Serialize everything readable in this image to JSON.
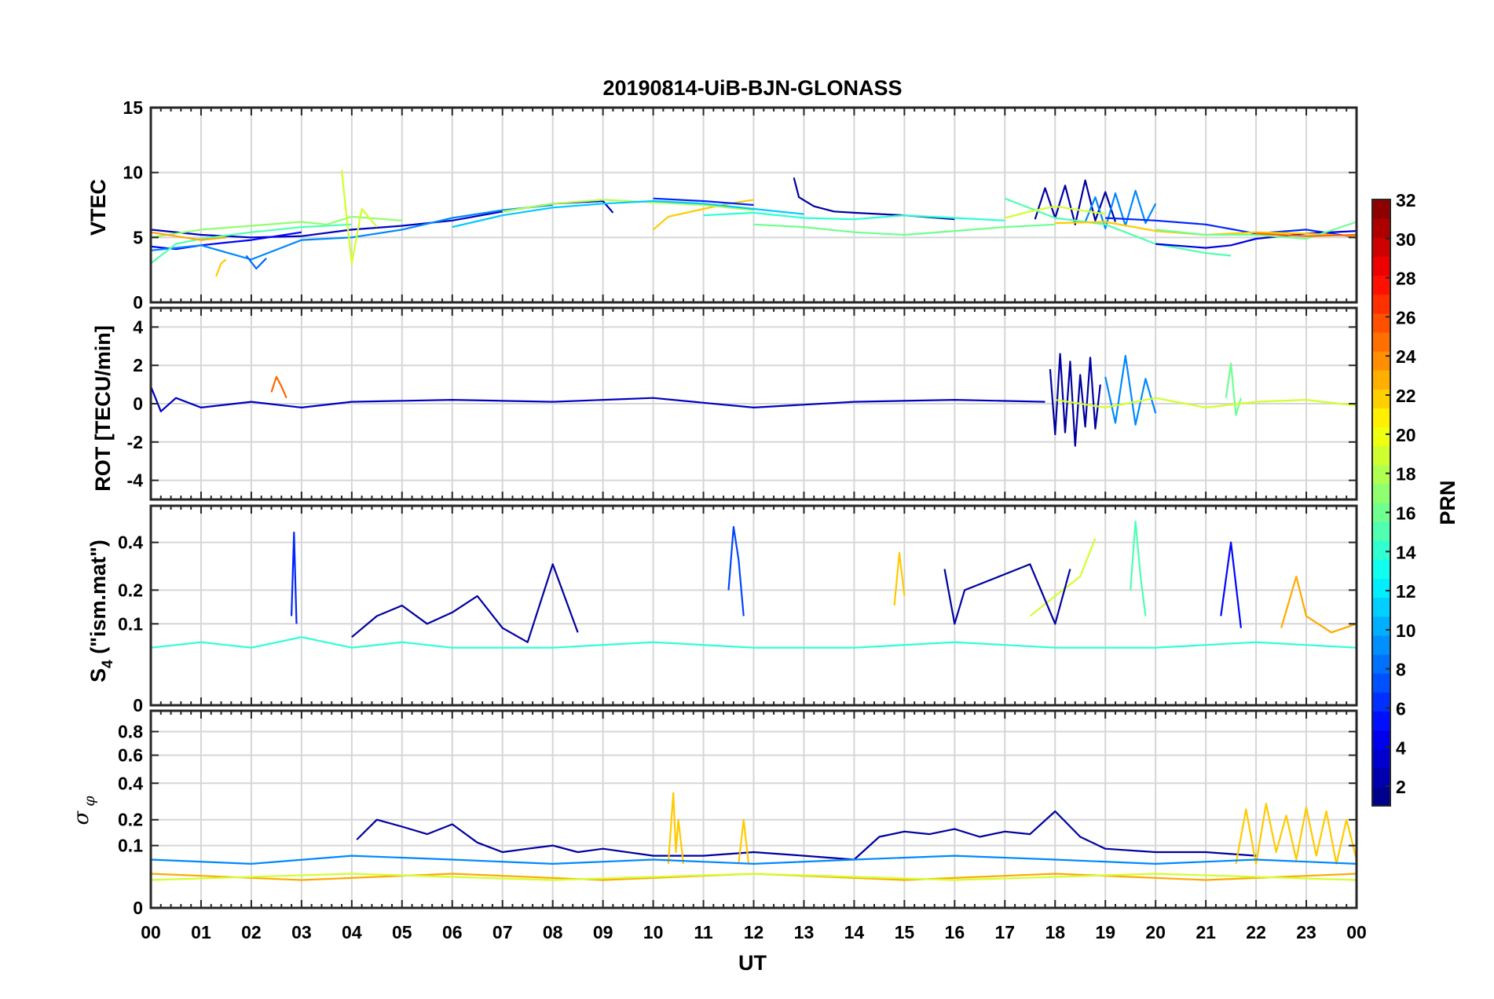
{
  "figure": {
    "title": "20190814-UiB-BJN-GLONASS",
    "xlabel": "UT",
    "x_ticks": [
      "00",
      "01",
      "02",
      "03",
      "04",
      "05",
      "06",
      "07",
      "08",
      "09",
      "10",
      "11",
      "12",
      "13",
      "14",
      "15",
      "16",
      "17",
      "18",
      "19",
      "20",
      "21",
      "22",
      "23",
      "00"
    ]
  },
  "colorbar": {
    "label": "PRN",
    "ticks": [
      "2",
      "4",
      "6",
      "8",
      "10",
      "12",
      "14",
      "16",
      "18",
      "20",
      "22",
      "24",
      "26",
      "28",
      "30",
      "32"
    ],
    "range": [
      1,
      32
    ],
    "colormap": "jet"
  },
  "chart_data": [
    {
      "type": "line",
      "ylabel": "VTEC",
      "xlim": [
        0,
        24
      ],
      "ylim": [
        0,
        15
      ],
      "y_ticks": [
        "0",
        "5",
        "10",
        "15"
      ],
      "grid": true,
      "series": [
        {
          "prn": 3,
          "x": [
            0,
            1,
            2,
            3,
            4,
            5,
            6,
            7,
            8,
            9,
            9.2
          ],
          "y": [
            5.6,
            5.2,
            5.0,
            5.1,
            5.6,
            5.9,
            6.3,
            7.0,
            7.6,
            7.8,
            6.9
          ]
        },
        {
          "prn": 5,
          "x": [
            0,
            0.5,
            1,
            1.5,
            2,
            2.5,
            3
          ],
          "y": [
            4.3,
            4.1,
            4.4,
            4.6,
            4.8,
            5.1,
            5.4
          ]
        },
        {
          "prn": 9,
          "x": [
            0,
            1,
            2,
            3,
            4,
            5,
            6,
            7,
            8
          ],
          "y": [
            4.0,
            4.4,
            3.3,
            4.8,
            5.0,
            5.6,
            6.5,
            7.1,
            7.5
          ]
        },
        {
          "prn": 15,
          "x": [
            0,
            0.5,
            1,
            2,
            3,
            4
          ],
          "y": [
            3.0,
            4.5,
            4.9,
            5.4,
            5.8,
            6.0
          ]
        },
        {
          "prn": 17,
          "x": [
            0,
            1,
            2,
            3,
            3.5,
            4,
            5
          ],
          "y": [
            5.0,
            5.6,
            5.9,
            6.2,
            6.0,
            6.6,
            6.3
          ]
        },
        {
          "prn": 19,
          "x": [
            3.8,
            3.9,
            4.0,
            4.2,
            4.5
          ],
          "y": [
            10.2,
            6.5,
            3.0,
            7.2,
            5.8
          ]
        },
        {
          "prn": 23,
          "x": [
            0,
            0.5,
            1,
            1.5
          ],
          "y": [
            5.4,
            5.1,
            4.8,
            5.0
          ]
        },
        {
          "prn": 22,
          "x": [
            1.3,
            1.4,
            1.5
          ],
          "y": [
            2.0,
            3.0,
            3.3
          ]
        },
        {
          "prn": 8,
          "x": [
            1.9,
            2.1,
            2.3
          ],
          "y": [
            3.6,
            2.6,
            3.4
          ]
        },
        {
          "prn": 22,
          "x": [
            10,
            10.3,
            11,
            11.5,
            12
          ],
          "y": [
            5.6,
            6.6,
            7.2,
            7.6,
            7.9
          ]
        },
        {
          "prn": 18,
          "x": [
            7,
            8,
            9,
            10,
            11,
            12
          ],
          "y": [
            7.0,
            7.6,
            7.9,
            7.7,
            7.5,
            7.1
          ]
        },
        {
          "prn": 11,
          "x": [
            6,
            7,
            8,
            9,
            10,
            11,
            12,
            13
          ],
          "y": [
            5.8,
            6.7,
            7.3,
            7.6,
            7.8,
            7.6,
            7.2,
            6.8
          ]
        },
        {
          "prn": 6,
          "x": [
            10,
            11,
            12
          ],
          "y": [
            8.0,
            7.8,
            7.5
          ]
        },
        {
          "prn": 2,
          "x": [
            12.8,
            12.9,
            13.2,
            13.6,
            14,
            15,
            16
          ],
          "y": [
            9.6,
            8.1,
            7.4,
            7.0,
            6.9,
            6.7,
            6.4
          ]
        },
        {
          "prn": 14,
          "x": [
            11,
            12,
            13,
            14,
            15,
            16,
            17
          ],
          "y": [
            6.7,
            6.9,
            6.5,
            6.4,
            6.7,
            6.5,
            6.3
          ]
        },
        {
          "prn": 16,
          "x": [
            12,
            13,
            14,
            15,
            16,
            17,
            18
          ],
          "y": [
            6.0,
            5.8,
            5.4,
            5.2,
            5.5,
            5.8,
            6.0
          ]
        },
        {
          "prn": 2,
          "x": [
            17.6,
            17.8,
            18,
            18.2,
            18.4,
            18.6,
            18.8,
            19.0,
            19.2
          ],
          "y": [
            6.4,
            8.8,
            6.5,
            9.0,
            6.0,
            9.4,
            6.3,
            8.5,
            6.2
          ]
        },
        {
          "prn": 9,
          "x": [
            18.6,
            18.8,
            19,
            19.2,
            19.4,
            19.6,
            19.8,
            20.0
          ],
          "y": [
            6.2,
            8.1,
            5.7,
            8.4,
            5.9,
            8.6,
            6.1,
            7.6
          ]
        },
        {
          "prn": 15,
          "x": [
            17,
            18,
            19,
            20,
            21,
            21.5
          ],
          "y": [
            8.0,
            6.5,
            6.0,
            4.5,
            3.8,
            3.6
          ]
        },
        {
          "prn": 6,
          "x": [
            19,
            20,
            21,
            22,
            23,
            24
          ],
          "y": [
            6.5,
            6.3,
            6.0,
            5.3,
            5.6,
            5.0
          ]
        },
        {
          "prn": 4,
          "x": [
            20,
            21,
            21.5,
            22,
            23,
            24
          ],
          "y": [
            4.5,
            4.2,
            4.4,
            4.9,
            5.3,
            5.5
          ]
        },
        {
          "prn": 22,
          "x": [
            18,
            19,
            20,
            21,
            22,
            23,
            24
          ],
          "y": [
            6.1,
            6.2,
            5.5,
            5.2,
            5.4,
            5.3,
            5.1
          ]
        },
        {
          "prn": 16,
          "x": [
            20,
            21,
            22,
            23,
            24
          ],
          "y": [
            5.6,
            5.2,
            5.2,
            4.9,
            6.2
          ]
        },
        {
          "prn": 19,
          "x": [
            17,
            17.5,
            18,
            19
          ],
          "y": [
            6.5,
            7.0,
            7.4,
            6.8
          ]
        },
        {
          "prn": 25,
          "x": [
            22,
            23,
            24
          ],
          "y": [
            5.3,
            5.1,
            5.2
          ]
        }
      ]
    },
    {
      "type": "line",
      "ylabel": "ROT [TECU/min]",
      "xlim": [
        0,
        24
      ],
      "ylim": [
        -5,
        5
      ],
      "y_ticks": [
        "-4",
        "-2",
        "0",
        "2",
        "4"
      ],
      "grid": true,
      "series": [
        {
          "prn": 3,
          "x": [
            0,
            0.2,
            0.5,
            1,
            2,
            3,
            4,
            6,
            8,
            10,
            12,
            14,
            16,
            17.8
          ],
          "y": [
            0.9,
            -0.4,
            0.3,
            -0.2,
            0.1,
            -0.2,
            0.1,
            0.2,
            0.1,
            0.3,
            -0.2,
            0.1,
            0.2,
            0.1
          ]
        },
        {
          "prn": 25,
          "x": [
            2.4,
            2.5,
            2.6,
            2.7
          ],
          "y": [
            0.6,
            1.4,
            0.9,
            0.3
          ]
        },
        {
          "prn": 2,
          "x": [
            17.9,
            18.0,
            18.1,
            18.2,
            18.3,
            18.4,
            18.5,
            18.6,
            18.7,
            18.8,
            18.9
          ],
          "y": [
            1.8,
            -1.6,
            2.6,
            -1.5,
            2.2,
            -2.2,
            1.5,
            -1.2,
            2.4,
            -1.3,
            1.0
          ]
        },
        {
          "prn": 9,
          "x": [
            19.0,
            19.2,
            19.4,
            19.6,
            19.8,
            20.0
          ],
          "y": [
            1.4,
            -1.0,
            2.5,
            -1.1,
            1.3,
            -0.5
          ]
        },
        {
          "prn": 16,
          "x": [
            21.4,
            21.5,
            21.6,
            21.7
          ],
          "y": [
            0.3,
            2.1,
            -0.6,
            0.3
          ]
        },
        {
          "prn": 19,
          "x": [
            18,
            19,
            20,
            21,
            22,
            23,
            24
          ],
          "y": [
            0.2,
            -0.2,
            0.3,
            -0.2,
            0.1,
            0.2,
            -0.1
          ]
        }
      ]
    },
    {
      "type": "line",
      "ylabel": "S4 (\"ism.mat\")",
      "xlim": [
        0,
        24
      ],
      "ylim": [
        0,
        0.6
      ],
      "y_ticks": [
        "0",
        "0.1",
        "0.2",
        "0.4"
      ],
      "grid": true,
      "series": [
        {
          "prn": 2,
          "x": [
            4,
            4.5,
            5,
            5.5,
            6,
            6.5,
            7,
            7.5,
            8,
            8.5
          ],
          "y": [
            0.07,
            0.12,
            0.15,
            0.1,
            0.13,
            0.18,
            0.09,
            0.06,
            0.3,
            0.08
          ]
        },
        {
          "prn": 6,
          "x": [
            2.8,
            2.85,
            2.9
          ],
          "y": [
            0.12,
            0.45,
            0.1
          ]
        },
        {
          "prn": 7,
          "x": [
            11.5,
            11.6,
            11.7,
            11.8
          ],
          "y": [
            0.2,
            0.48,
            0.32,
            0.12
          ]
        },
        {
          "prn": 15,
          "x": [
            19.5,
            19.6,
            19.7,
            19.8
          ],
          "y": [
            0.2,
            0.51,
            0.25,
            0.12
          ]
        },
        {
          "prn": 22,
          "x": [
            14.8,
            14.9,
            15.0
          ],
          "y": [
            0.15,
            0.35,
            0.18
          ]
        },
        {
          "prn": 19,
          "x": [
            17.5,
            18,
            18.5,
            18.8
          ],
          "y": [
            0.12,
            0.18,
            0.25,
            0.42
          ]
        },
        {
          "prn": 2,
          "x": [
            15.8,
            16,
            16.2,
            17.5,
            18,
            18.3
          ],
          "y": [
            0.28,
            0.1,
            0.2,
            0.3,
            0.1,
            0.28
          ]
        },
        {
          "prn": 5,
          "x": [
            21.3,
            21.5,
            21.7
          ],
          "y": [
            0.12,
            0.4,
            0.09
          ]
        },
        {
          "prn": 23,
          "x": [
            22.5,
            22.8,
            23,
            23.5,
            24
          ],
          "y": [
            0.09,
            0.25,
            0.12,
            0.08,
            0.1
          ]
        },
        {
          "prn": 14,
          "x": [
            0,
            1,
            2,
            3,
            4,
            5,
            6,
            8,
            10,
            12,
            14,
            16,
            18,
            20,
            22,
            24
          ],
          "y": [
            0.05,
            0.06,
            0.05,
            0.07,
            0.05,
            0.06,
            0.05,
            0.05,
            0.06,
            0.05,
            0.05,
            0.06,
            0.05,
            0.05,
            0.06,
            0.05
          ]
        }
      ]
    },
    {
      "type": "line",
      "ylabel": "σφ",
      "xlim": [
        0,
        24
      ],
      "ylim": [
        0,
        1
      ],
      "y_ticks": [
        "0",
        "0.1",
        "0.2",
        "0.4",
        "0.6",
        "0.8"
      ],
      "grid": true,
      "series": [
        {
          "prn": 2,
          "x": [
            4.1,
            4.5,
            5,
            5.5,
            6,
            6.5,
            7,
            7.5,
            8,
            8.5,
            9,
            10,
            11,
            12,
            13,
            14,
            14.5,
            15,
            15.5,
            16,
            16.5,
            17,
            17.5,
            18,
            18.5,
            19,
            20,
            21,
            22
          ],
          "y": [
            0.12,
            0.2,
            0.17,
            0.14,
            0.18,
            0.11,
            0.08,
            0.09,
            0.1,
            0.08,
            0.09,
            0.07,
            0.07,
            0.08,
            0.07,
            0.06,
            0.13,
            0.15,
            0.14,
            0.16,
            0.13,
            0.15,
            0.14,
            0.24,
            0.13,
            0.09,
            0.08,
            0.08,
            0.07
          ]
        },
        {
          "prn": 22,
          "x": [
            10.3,
            10.4,
            10.45,
            10.5,
            10.6
          ],
          "y": [
            0.05,
            0.34,
            0.08,
            0.2,
            0.05
          ]
        },
        {
          "prn": 22,
          "x": [
            11.7,
            11.8,
            11.9
          ],
          "y": [
            0.05,
            0.2,
            0.05
          ]
        },
        {
          "prn": 22,
          "x": [
            21.6,
            21.8,
            22,
            22.2,
            22.4,
            22.6,
            22.8,
            23,
            23.2,
            23.4,
            23.6,
            23.8,
            24
          ],
          "y": [
            0.05,
            0.25,
            0.05,
            0.28,
            0.08,
            0.22,
            0.06,
            0.26,
            0.07,
            0.24,
            0.05,
            0.2,
            0.06
          ]
        },
        {
          "prn": 9,
          "x": [
            0,
            2,
            4,
            6,
            8,
            10,
            12,
            14,
            16,
            18,
            20,
            22,
            24
          ],
          "y": [
            0.06,
            0.05,
            0.07,
            0.06,
            0.05,
            0.06,
            0.05,
            0.06,
            0.07,
            0.06,
            0.05,
            0.06,
            0.05
          ]
        },
        {
          "prn": 23,
          "x": [
            0,
            3,
            6,
            9,
            12,
            15,
            18,
            21,
            24
          ],
          "y": [
            0.03,
            0.02,
            0.03,
            0.02,
            0.03,
            0.02,
            0.03,
            0.02,
            0.03
          ]
        },
        {
          "prn": 19,
          "x": [
            0,
            4,
            8,
            12,
            16,
            20,
            24
          ],
          "y": [
            0.02,
            0.03,
            0.02,
            0.03,
            0.02,
            0.03,
            0.02
          ]
        }
      ]
    }
  ]
}
